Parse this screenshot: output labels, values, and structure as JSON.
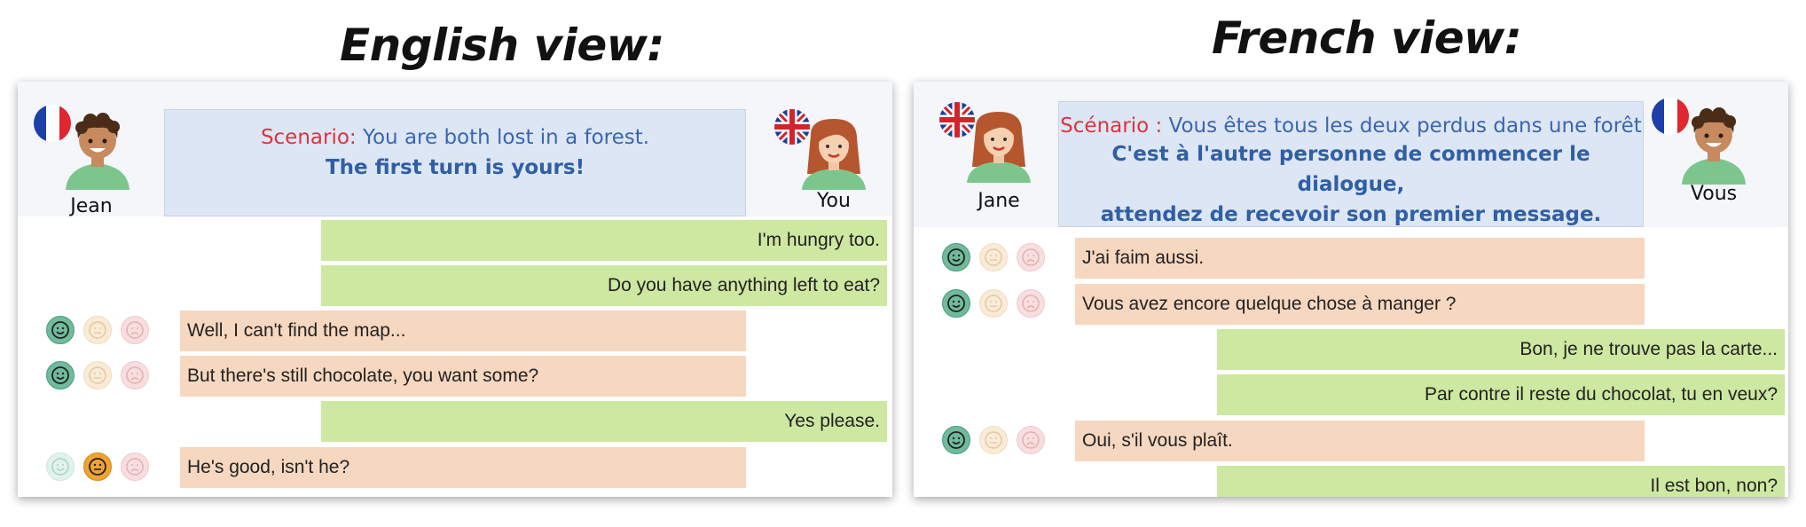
{
  "left": {
    "view_title": "English view:",
    "partner_name": "Jean",
    "self_name": "You",
    "scenario_label": "Scenario:",
    "scenario_text": " You are both lost in a forest.",
    "scenario_line2": "The first turn is yours!",
    "messages": [
      {
        "side": "self",
        "text": "I'm hungry too."
      },
      {
        "side": "self",
        "text": "Do you have anything left to eat?"
      },
      {
        "side": "partner",
        "text": "Well, I can't find the map...",
        "rating": "happy"
      },
      {
        "side": "partner",
        "text": "But there's still chocolate, you want some?",
        "rating": "happy"
      },
      {
        "side": "self",
        "text": "Yes please."
      },
      {
        "side": "partner",
        "text": "He's good, isn't he?",
        "rating": "neutral"
      }
    ]
  },
  "right": {
    "view_title": "French view:",
    "partner_name": "Jane",
    "self_name": "Vous",
    "scenario_label": "Scénario :",
    "scenario_text": " Vous êtes tous les deux perdus dans une forêt",
    "scenario_line2": "C'est à l'autre personne de commencer le dialogue,",
    "scenario_line3": "attendez de recevoir son premier message.",
    "messages": [
      {
        "side": "partner",
        "text": "J'ai faim aussi.",
        "rating": "happy"
      },
      {
        "side": "partner",
        "text": "Vous avez encore quelque chose à manger ?",
        "rating": "happy"
      },
      {
        "side": "self",
        "text": "Bon, je ne trouve pas la carte..."
      },
      {
        "side": "self",
        "text": "Par contre il reste du chocolat, tu en veux?"
      },
      {
        "side": "partner",
        "text": "Oui, s'il vous plaît.",
        "rating": "happy"
      },
      {
        "side": "self",
        "text": "Il est bon, non?"
      }
    ]
  },
  "colors": {
    "self_bubble": "#cde8a0",
    "partner_bubble": "#f6d7bf",
    "scenario_label": "#d9363e",
    "scenario_text": "#3a66b0"
  },
  "icons": [
    "french-flag-icon",
    "uk-flag-icon",
    "male-avatar-icon",
    "female-avatar-icon",
    "happy-face-icon",
    "neutral-face-icon",
    "sad-face-icon"
  ]
}
